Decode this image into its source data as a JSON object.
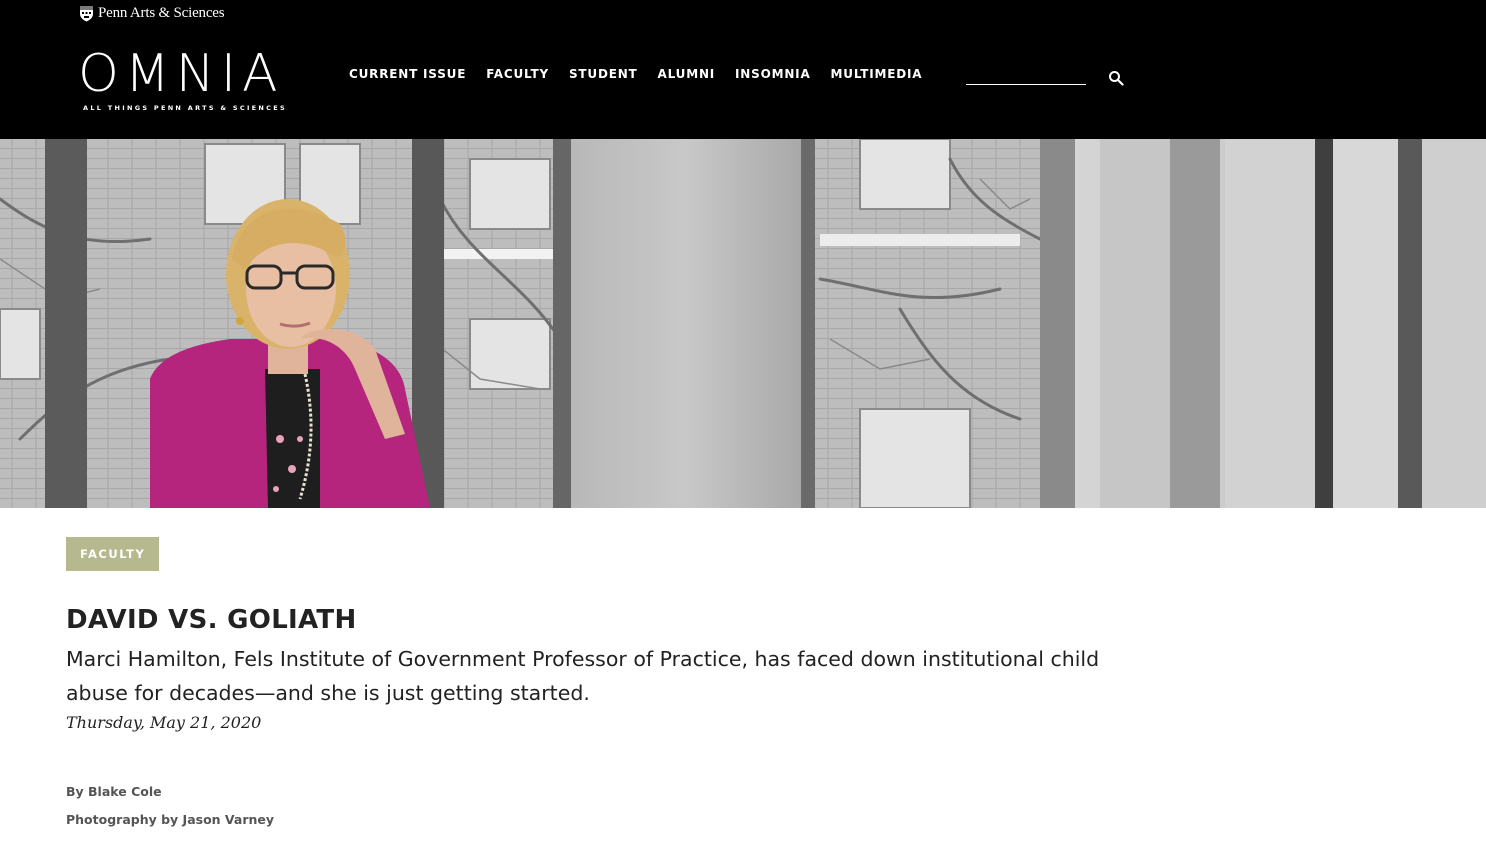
{
  "header": {
    "brand_text": "Penn Arts & Sciences",
    "logo_word": "OMNIA",
    "logo_tagline": "ALL THINGS PENN ARTS & SCIENCES",
    "nav": [
      {
        "label": "CURRENT ISSUE"
      },
      {
        "label": "FACULTY"
      },
      {
        "label": "STUDENT"
      },
      {
        "label": "ALUMNI"
      },
      {
        "label": "INSOMNIA"
      },
      {
        "label": "MULTIMEDIA"
      }
    ],
    "search": {
      "placeholder": "",
      "value": "",
      "icon": "search-icon"
    }
  },
  "hero": {
    "icon": "portrait-photo"
  },
  "article": {
    "category": "FACULTY",
    "title": "DAVID VS. GOLIATH",
    "subtitle": "Marci Hamilton, Fels Institute of Government Professor of Practice, has faced down institutional child abuse for decades—and she is just getting started.",
    "date": "Thursday, May 21, 2020",
    "author": "By Blake Cole",
    "photographer": "Photography by Jason Varney"
  },
  "colors": {
    "header_bg": "#000000",
    "tag_bg": "#b6b98e",
    "blazer": "#b5257d"
  }
}
